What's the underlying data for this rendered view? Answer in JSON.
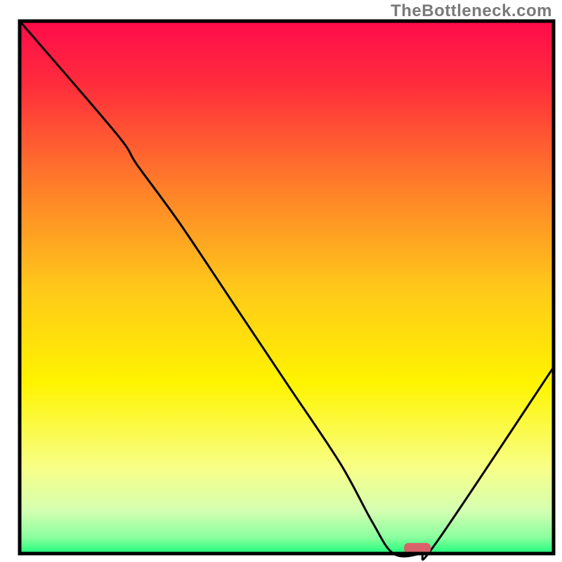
{
  "watermark": "TheBottleneck.com",
  "chart_data": {
    "type": "line",
    "title": "",
    "xlabel": "",
    "ylabel": "",
    "xlim": [
      0,
      100
    ],
    "ylim": [
      0,
      100
    ],
    "x": [
      0,
      18,
      22,
      30,
      40,
      50,
      60,
      66,
      70,
      75,
      78,
      100
    ],
    "values": [
      100,
      79,
      73,
      62,
      47,
      32,
      17,
      6,
      0,
      0,
      2,
      35
    ],
    "gradient_stops": [
      {
        "offset": 0.0,
        "color": "#ff0b4b"
      },
      {
        "offset": 0.12,
        "color": "#ff2d3c"
      },
      {
        "offset": 0.3,
        "color": "#ff7a2a"
      },
      {
        "offset": 0.5,
        "color": "#ffc81a"
      },
      {
        "offset": 0.68,
        "color": "#fff400"
      },
      {
        "offset": 0.84,
        "color": "#f7ff88"
      },
      {
        "offset": 0.92,
        "color": "#d4ffb2"
      },
      {
        "offset": 0.97,
        "color": "#8aff9e"
      },
      {
        "offset": 1.0,
        "color": "#1cff7a"
      }
    ],
    "marker": {
      "x": 72,
      "y": 0,
      "width": 5,
      "height": 2,
      "color": "#d9626a"
    },
    "frame_color": "#000000",
    "curve_color": "#000000",
    "curve_width": 3
  }
}
